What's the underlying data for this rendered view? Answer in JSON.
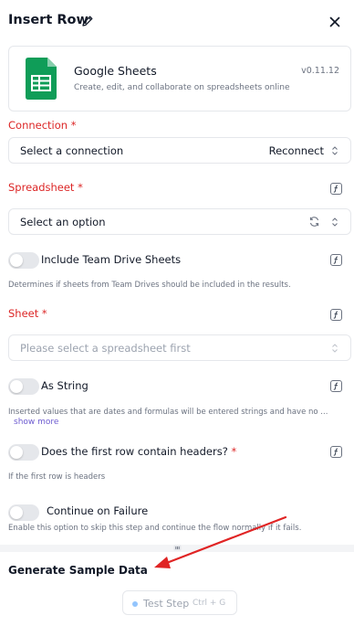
{
  "header": {
    "title": "Insert Row",
    "edit_icon": "pencil-icon",
    "close_icon": "close-icon"
  },
  "piece": {
    "name": "Google Sheets",
    "description": "Create, edit, and collaborate on spreadsheets online",
    "version": "v0.11.12",
    "logo_icon": "google-sheets-logo"
  },
  "connection": {
    "label": "Connection",
    "required_mark": "*",
    "placeholder": "Select a connection",
    "action_label": "Reconnect"
  },
  "spreadsheet": {
    "label": "Spreadsheet",
    "required_mark": "*",
    "value": "Select an option"
  },
  "include_team_drive": {
    "label": "Include Team Drive Sheets",
    "help": "Determines if sheets from Team Drives should be included in the results.",
    "enabled": false
  },
  "sheet": {
    "label": "Sheet",
    "required_mark": "*",
    "placeholder": "Please select a spreadsheet first"
  },
  "as_string": {
    "label": "As String",
    "help": "Inserted values that are dates and formulas will be entered strings and have no ...",
    "show_more": "show more",
    "enabled": false
  },
  "first_row_headers": {
    "label": "Does the first row contain headers?",
    "required_mark": "*",
    "help": "If the first row is headers",
    "enabled": false
  },
  "continue_on_failure": {
    "label": "Continue on Failure",
    "help": "Enable this option to skip this step and continue the flow normally if it fails.",
    "enabled": false
  },
  "sample_data": {
    "title": "Generate Sample Data",
    "test_button": "Test Step",
    "shortcut": "Ctrl + G"
  },
  "colors": {
    "required_red": "#dc2626",
    "annotation_arrow": "#e02424",
    "link_purple": "#6d5bd0",
    "sheets_green": "#0f9d58"
  }
}
